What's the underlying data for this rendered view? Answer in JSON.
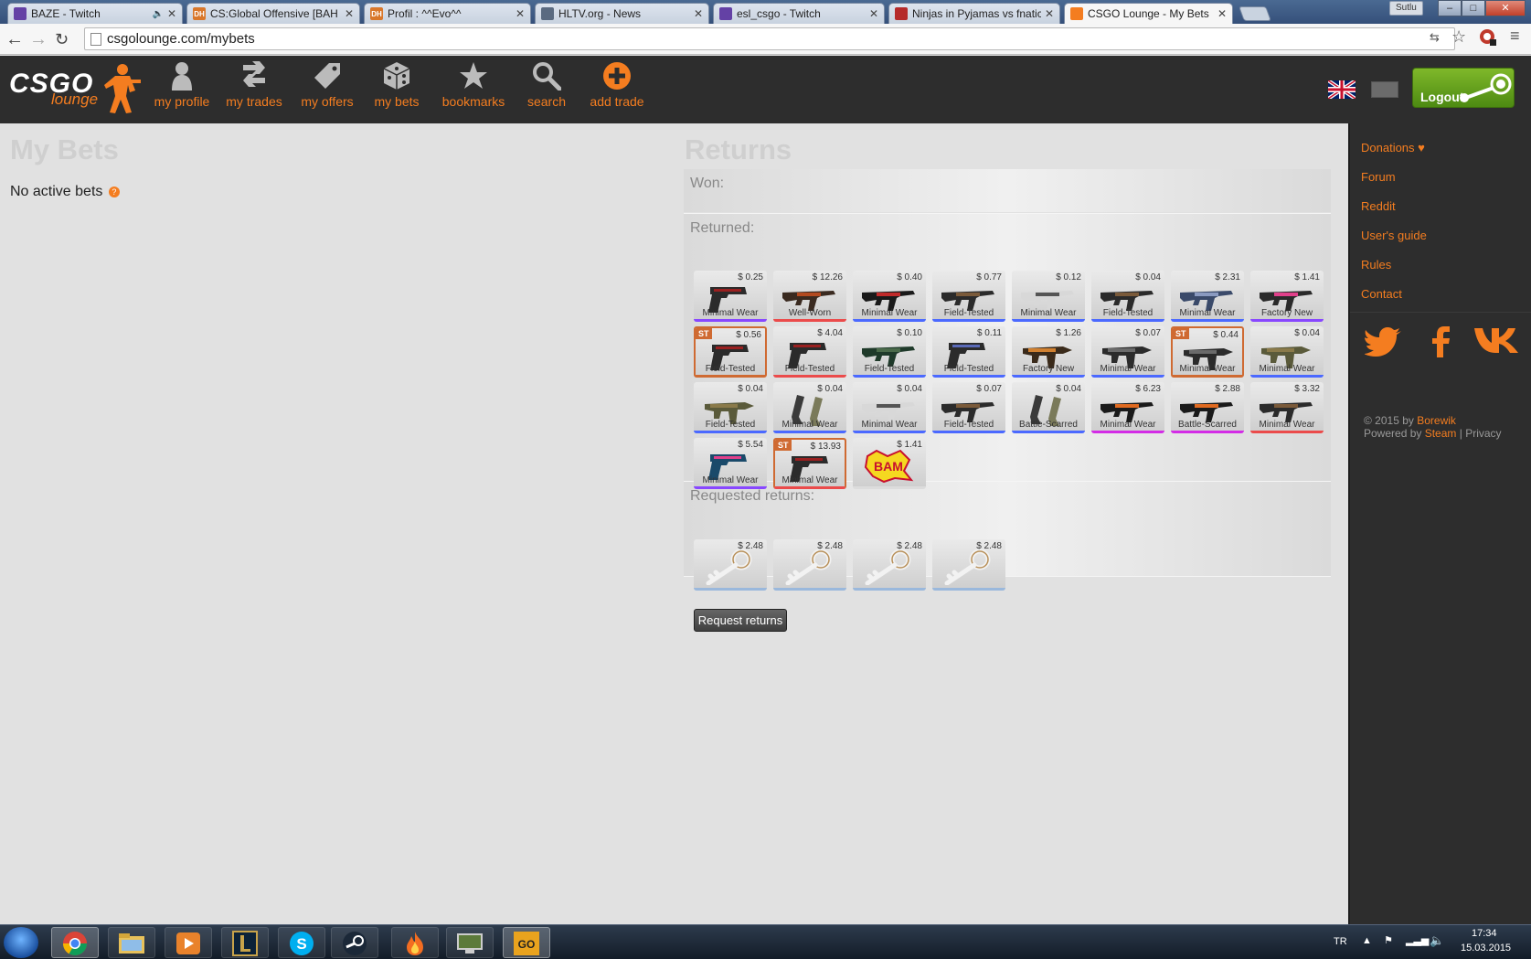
{
  "browser": {
    "tabs": [
      {
        "title": "BAZE - Twitch",
        "icon": "twitch-icon",
        "color": "#6441a5",
        "muted": true
      },
      {
        "title": "CS:Global Offensive [BAH",
        "icon": "dh-icon",
        "color": "#d9772a",
        "favtext": "DH"
      },
      {
        "title": "Profil : ^^Evo^^",
        "icon": "dh-icon",
        "color": "#d9772a",
        "favtext": "DH"
      },
      {
        "title": "HLTV.org - News",
        "icon": "hltv-icon",
        "color": "#5a6a80"
      },
      {
        "title": "esl_csgo - Twitch",
        "icon": "twitch-icon",
        "color": "#6441a5"
      },
      {
        "title": "Ninjas in Pyjamas vs fnatic",
        "icon": "gosugamers-icon",
        "color": "#b52a2a"
      },
      {
        "title": "CSGO Lounge - My Bets",
        "icon": "csgolounge-icon",
        "color": "#f47d20",
        "active": true
      }
    ],
    "user": "Sutlu",
    "url": "csgolounge.com/mybets"
  },
  "site": {
    "logo_main": "CSGO",
    "logo_sub": "lounge",
    "nav": [
      {
        "label": "my profile",
        "icon": "profile-icon"
      },
      {
        "label": "my trades",
        "icon": "trades-icon"
      },
      {
        "label": "my offers",
        "icon": "tag-icon"
      },
      {
        "label": "my bets",
        "icon": "dice-icon"
      },
      {
        "label": "bookmarks",
        "icon": "star-icon"
      },
      {
        "label": "search",
        "icon": "search-icon"
      },
      {
        "label": "add trade",
        "icon": "plus-circle-icon"
      }
    ],
    "logout_label": "Logout"
  },
  "my_bets": {
    "title": "My Bets",
    "empty_text": "No active bets",
    "help_glyph": "?"
  },
  "returns": {
    "title": "Returns",
    "won_label": "Won:",
    "returned_label": "Returned:",
    "requested_label": "Requested returns:",
    "returned_items": [
      {
        "price": "$ 0.25",
        "wear": "Minimal Wear",
        "rarity": "#8847ff",
        "weapon": "pistol"
      },
      {
        "price": "$ 12.26",
        "wear": "Well-Worn",
        "rarity": "#eb4b4b",
        "weapon": "ak"
      },
      {
        "price": "$ 0.40",
        "wear": "Minimal Wear",
        "rarity": "#4b69ff",
        "weapon": "rifle-red"
      },
      {
        "price": "$ 0.77",
        "wear": "Field-Tested",
        "rarity": "#4b69ff",
        "weapon": "rifle"
      },
      {
        "price": "$ 0.12",
        "wear": "Minimal Wear",
        "rarity": "#4b69ff",
        "weapon": "rifle-white"
      },
      {
        "price": "$ 0.04",
        "wear": "Field-Tested",
        "rarity": "#4b69ff",
        "weapon": "rifle"
      },
      {
        "price": "$ 2.31",
        "wear": "Minimal Wear",
        "rarity": "#4b69ff",
        "weapon": "rifle-blue"
      },
      {
        "price": "$ 1.41",
        "wear": "Factory New",
        "rarity": "#8847ff",
        "weapon": "rifle-pink"
      },
      {
        "price": "$ 0.56",
        "wear": "Field-Tested",
        "rarity": "#cf6a32",
        "weapon": "pistol",
        "st": true
      },
      {
        "price": "$ 4.04",
        "wear": "Field-Tested",
        "rarity": "#eb4b4b",
        "weapon": "pistol"
      },
      {
        "price": "$ 0.10",
        "wear": "Field-Tested",
        "rarity": "#4b69ff",
        "weapon": "rifle-green"
      },
      {
        "price": "$ 0.11",
        "wear": "Field-Tested",
        "rarity": "#4b69ff",
        "weapon": "pistol-blue"
      },
      {
        "price": "$ 1.26",
        "wear": "Factory New",
        "rarity": "#4b69ff",
        "weapon": "smg-orange"
      },
      {
        "price": "$ 0.07",
        "wear": "Minimal Wear",
        "rarity": "#4b69ff",
        "weapon": "smg"
      },
      {
        "price": "$ 0.44",
        "wear": "Minimal Wear",
        "rarity": "#cf6a32",
        "weapon": "smg",
        "st": true
      },
      {
        "price": "$ 0.04",
        "wear": "Minimal Wear",
        "rarity": "#4b69ff",
        "weapon": "smg-camo"
      },
      {
        "price": "$ 0.04",
        "wear": "Field-Tested",
        "rarity": "#4b69ff",
        "weapon": "smg-camo"
      },
      {
        "price": "$ 0.04",
        "wear": "Minimal Wear",
        "rarity": "#4b69ff",
        "weapon": "dual"
      },
      {
        "price": "$ 0.04",
        "wear": "Minimal Wear",
        "rarity": "#4b69ff",
        "weapon": "rifle-white"
      },
      {
        "price": "$ 0.07",
        "wear": "Field-Tested",
        "rarity": "#4b69ff",
        "weapon": "rifle"
      },
      {
        "price": "$ 0.04",
        "wear": "Battle-Scarred",
        "rarity": "#4b69ff",
        "weapon": "dual"
      },
      {
        "price": "$ 6.23",
        "wear": "Minimal Wear",
        "rarity": "#d32ce6",
        "weapon": "rifle-orange"
      },
      {
        "price": "$ 2.88",
        "wear": "Battle-Scarred",
        "rarity": "#d32ce6",
        "weapon": "rifle-orange"
      },
      {
        "price": "$ 3.32",
        "wear": "Minimal Wear",
        "rarity": "#eb4b4b",
        "weapon": "rifle"
      },
      {
        "price": "$ 5.54",
        "wear": "Minimal Wear",
        "rarity": "#8847ff",
        "weapon": "pistol-pink"
      },
      {
        "price": "$ 13.93",
        "wear": "Minimal Wear",
        "rarity": "#eb4b4b",
        "weapon": "pistol",
        "st": true
      },
      {
        "price": "$ 1.41",
        "wear": "",
        "rarity": "#dcdcdc",
        "weapon": "sticker"
      }
    ],
    "requested_items": [
      {
        "price": "$ 2.48",
        "weapon": "key"
      },
      {
        "price": "$ 2.48",
        "weapon": "key"
      },
      {
        "price": "$ 2.48",
        "weapon": "key"
      },
      {
        "price": "$ 2.48",
        "weapon": "key"
      }
    ],
    "st_badge": "ST",
    "request_button": "Request returns"
  },
  "sidebar": {
    "links": [
      "Donations ♥",
      "Forum",
      "Reddit",
      "User's guide",
      "Rules",
      "Contact"
    ],
    "social": [
      "twitter-icon",
      "facebook-icon",
      "vk-icon"
    ],
    "footer_copy": "© 2015 by ",
    "footer_author": "Borewik",
    "footer_powered": "Powered by ",
    "footer_steam": "Steam",
    "footer_sep": " | ",
    "footer_privacy": "Privacy"
  },
  "taskbar": {
    "lang": "TR",
    "time": "17:34",
    "date": "15.03.2015"
  },
  "colors": {
    "accent": "#f47d20",
    "header_bg": "#2d2d2d",
    "content_bg": "#e1e1e1"
  }
}
